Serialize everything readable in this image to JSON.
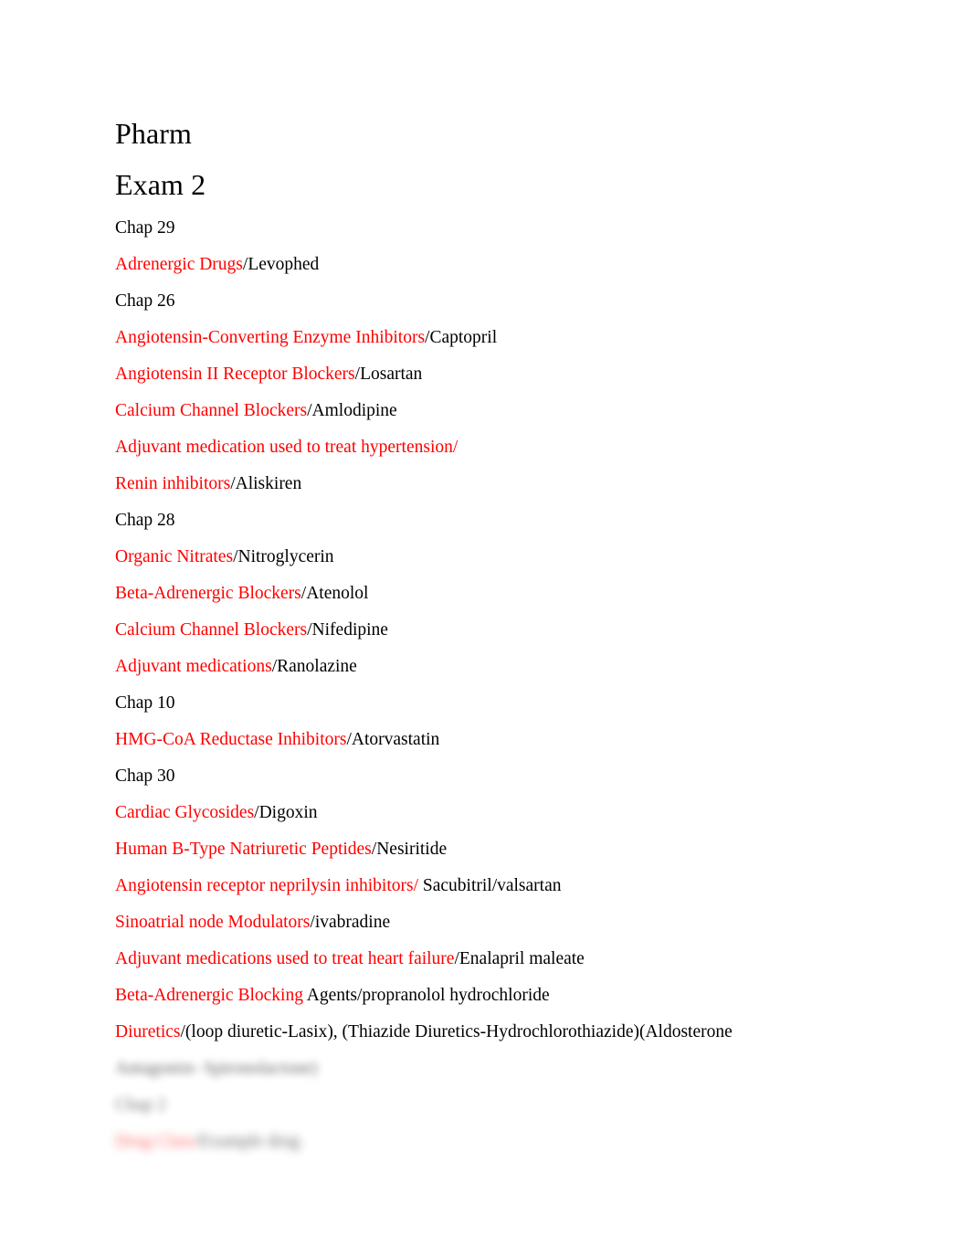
{
  "document": {
    "title_lines": [
      "Pharm",
      "Exam 2"
    ],
    "accent_red": "#ff0000",
    "text_black": "#000000",
    "background": "#ffffff"
  },
  "sections": [
    {
      "chapter": "Chap 29",
      "entries": [
        {
          "drug_class": "Adrenergic Drugs",
          "separator": "/",
          "example": "Levophed"
        }
      ]
    },
    {
      "chapter": "Chap 26",
      "entries": [
        {
          "drug_class": "Angiotensin-Converting Enzyme Inhibitors",
          "separator": "/",
          "example": "Captopril"
        },
        {
          "drug_class": "Angiotensin II Receptor Blockers",
          "separator": "/",
          "example": "Losartan"
        },
        {
          "drug_class": "Calcium Channel Blockers",
          "separator": "/",
          "example": "Amlodipine"
        },
        {
          "drug_class": "Adjuvant medication used to treat hypertension/",
          "separator": "",
          "example": ""
        },
        {
          "drug_class": "Renin inhibitors",
          "separator": "/",
          "example": "Aliskiren"
        }
      ]
    },
    {
      "chapter": "Chap 28",
      "entries": [
        {
          "drug_class": "Organic Nitrates",
          "separator": "/",
          "example": "Nitroglycerin"
        },
        {
          "drug_class": "Beta-Adrenergic Blockers",
          "separator": "/",
          "example": "Atenolol"
        },
        {
          "drug_class": "Calcium Channel Blockers",
          "separator": "/",
          "example": "Nifedipine"
        },
        {
          "drug_class": "Adjuvant medications",
          "separator": "/",
          "example": "Ranolazine"
        }
      ]
    },
    {
      "chapter": "Chap 10",
      "entries": [
        {
          "drug_class": "HMG-CoA Reductase Inhibitors",
          "separator": "/",
          "example": "Atorvastatin"
        }
      ]
    },
    {
      "chapter": "Chap 30",
      "entries": [
        {
          "drug_class": "Cardiac Glycosides",
          "separator": "/",
          "example": "Digoxin"
        },
        {
          "drug_class": "Human B-Type Natriuretic Peptides",
          "separator": "/",
          "example": "Nesiritide"
        },
        {
          "drug_class": "Angiotensin receptor neprilysin inhibitors/",
          "separator": "",
          "example": " Sacubitril/valsartan"
        },
        {
          "drug_class": "Sinoatrial node Modulators",
          "separator": "/",
          "example": "ivabradine"
        },
        {
          "drug_class": "Adjuvant medications used to treat heart failure",
          "separator": "/",
          "example": "Enalapril maleate"
        },
        {
          "drug_class": "Beta-Adrenergic Blocking ",
          "separator": "",
          "example": "Agents/propranolol hydrochloride"
        },
        {
          "drug_class": "Diuretics",
          "separator": "/",
          "example": "(loop diuretic-Lasix), (Thiazide Diuretics-Hydrochlorothiazide)(Aldosterone"
        }
      ]
    }
  ],
  "obscured": {
    "continuation_line": "Antagonist- Spironolactone)",
    "chapter_line": "Chap 2",
    "entry_line_red": "Drug Class",
    "entry_line_black": "/Example drug"
  }
}
